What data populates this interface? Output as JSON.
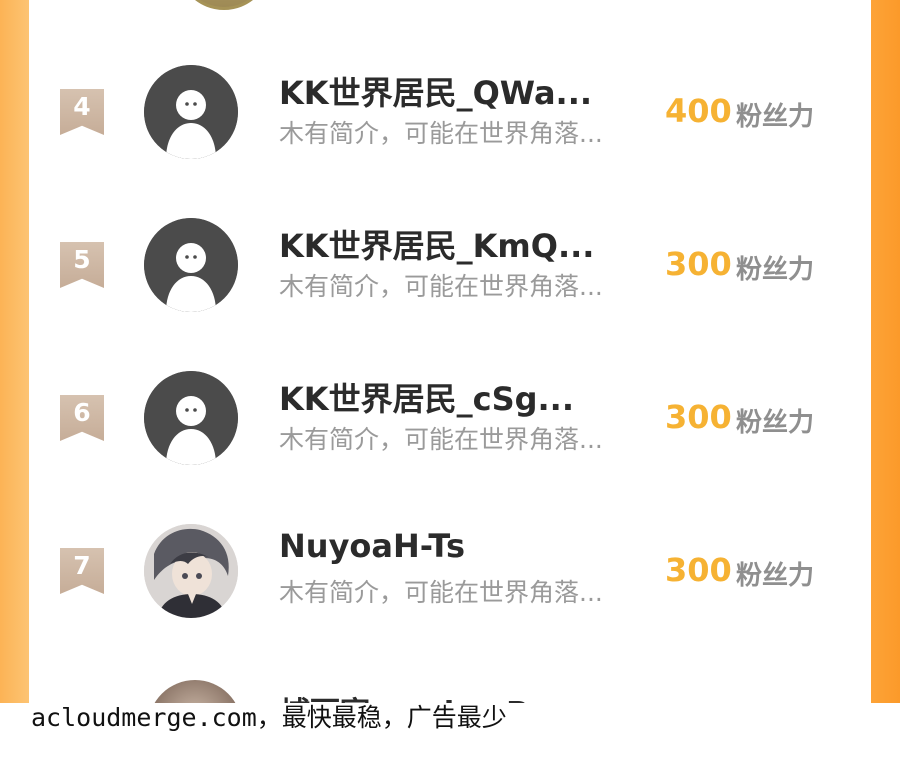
{
  "list": {
    "rows": [
      {
        "rank": "4",
        "name": "KK世界居民_QWa...",
        "bio": "木有简介，可能在世界角落...",
        "score": "400",
        "unit": "粉丝力",
        "avatar": "default-avatar"
      },
      {
        "rank": "5",
        "name": "KK世界居民_KmQ...",
        "bio": "木有简介，可能在世界角落...",
        "score": "300",
        "unit": "粉丝力",
        "avatar": "default-avatar"
      },
      {
        "rank": "6",
        "name": "KK世界居民_cSg...",
        "bio": "木有简介，可能在世界角落...",
        "score": "300",
        "unit": "粉丝力",
        "avatar": "default-avatar"
      },
      {
        "rank": "7",
        "name": "NuyoaH-Ts",
        "bio": "木有简介，可能在世界角落...",
        "score": "300",
        "unit": "粉丝力",
        "avatar": "anime-portrait-avatar"
      }
    ],
    "partial_bottom_name": "埔丽宸 ....ɔlɔ...P"
  },
  "watermark": {
    "text": "acloudmerge.com，最快最稳，广告最少"
  },
  "colors": {
    "score": "#f6b233",
    "rank_badge": "#c6ad98",
    "side_bg_left": "#fcb355",
    "side_bg_right": "#fb9a2a"
  }
}
